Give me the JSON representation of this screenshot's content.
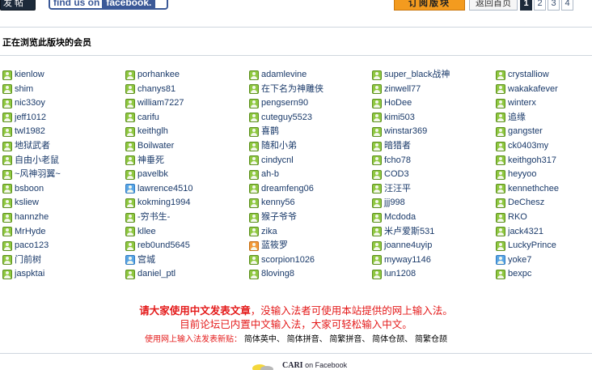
{
  "topbar": {
    "post_label": "发 帖",
    "facebook_find": "find us on",
    "facebook_name": "facebook.",
    "subscribe_label": "订阅版块",
    "back_label": "返回首页",
    "pages": [
      "1",
      "2",
      "3",
      "4"
    ],
    "current_page": "1"
  },
  "section": {
    "title": "正在浏览此版块的会员"
  },
  "members": [
    [
      {
        "name": "kienlow",
        "icon": "green-user-icon"
      },
      {
        "name": "shim",
        "icon": "green-user-icon"
      },
      {
        "name": "nic33oy",
        "icon": "green-user-icon"
      },
      {
        "name": "jeff1012",
        "icon": "green-user-icon"
      },
      {
        "name": "twl1982",
        "icon": "green-user-icon"
      },
      {
        "name": "地狱武者",
        "icon": "green-user-icon"
      },
      {
        "name": "自由小老鼠",
        "icon": "green-user-icon"
      },
      {
        "name": "~风神羽翼~",
        "icon": "green-user-icon"
      },
      {
        "name": "bsboon",
        "icon": "green-user-icon"
      },
      {
        "name": "ksliew",
        "icon": "green-user-icon"
      },
      {
        "name": "hannzhe",
        "icon": "green-user-icon"
      },
      {
        "name": "MrHyde",
        "icon": "green-user-icon"
      },
      {
        "name": "paco123",
        "icon": "green-user-icon"
      },
      {
        "name": "门前树",
        "icon": "green-user-icon"
      },
      {
        "name": "jaspktai",
        "icon": "green-user-icon"
      }
    ],
    [
      {
        "name": "porhankee",
        "icon": "green-user-icon"
      },
      {
        "name": "chanys81",
        "icon": "green-user-icon"
      },
      {
        "name": "william7227",
        "icon": "green-user-icon"
      },
      {
        "name": "carifu",
        "icon": "green-user-icon"
      },
      {
        "name": "keithglh",
        "icon": "green-user-icon"
      },
      {
        "name": "Boilwater",
        "icon": "green-user-icon"
      },
      {
        "name": "神垂死",
        "icon": "green-user-icon"
      },
      {
        "name": "pavelbk",
        "icon": "green-user-icon"
      },
      {
        "name": "lawrence4510",
        "icon": "blue-user-icon"
      },
      {
        "name": "kokming1994",
        "icon": "green-user-icon"
      },
      {
        "name": "-穷书生-",
        "icon": "green-user-icon"
      },
      {
        "name": "kllee",
        "icon": "green-user-icon"
      },
      {
        "name": "reb0und5645",
        "icon": "green-user-icon"
      },
      {
        "name": "宫城",
        "icon": "blue-user-icon"
      },
      {
        "name": "daniel_ptl",
        "icon": "green-user-icon"
      }
    ],
    [
      {
        "name": "adamlevine",
        "icon": "green-user-icon"
      },
      {
        "name": "在下名为神雕侠",
        "icon": "green-user-icon"
      },
      {
        "name": "pengsern90",
        "icon": "green-user-icon"
      },
      {
        "name": "cuteguy5523",
        "icon": "green-user-icon"
      },
      {
        "name": "喜鹊",
        "icon": "green-user-icon"
      },
      {
        "name": "随和小弟",
        "icon": "green-user-icon"
      },
      {
        "name": "cindycnl",
        "icon": "green-user-icon"
      },
      {
        "name": "ah-b",
        "icon": "green-user-icon"
      },
      {
        "name": "dreamfeng06",
        "icon": "green-user-icon"
      },
      {
        "name": "kenny56",
        "icon": "green-user-icon"
      },
      {
        "name": "猴子爷爷",
        "icon": "green-user-icon"
      },
      {
        "name": "zika",
        "icon": "green-user-icon"
      },
      {
        "name": "蓝筱罗",
        "icon": "orange-user-icon"
      },
      {
        "name": "scorpion1026",
        "icon": "green-user-icon"
      },
      {
        "name": "8loving8",
        "icon": "green-user-icon"
      }
    ],
    [
      {
        "name": "super_black战神",
        "icon": "green-user-icon"
      },
      {
        "name": "zinwell77",
        "icon": "green-user-icon"
      },
      {
        "name": "HoDee",
        "icon": "green-user-icon"
      },
      {
        "name": "kimi503",
        "icon": "green-user-icon"
      },
      {
        "name": "winstar369",
        "icon": "green-user-icon"
      },
      {
        "name": "暗猎者",
        "icon": "green-user-icon"
      },
      {
        "name": "fcho78",
        "icon": "green-user-icon"
      },
      {
        "name": "COD3",
        "icon": "green-user-icon"
      },
      {
        "name": "汪汪平",
        "icon": "green-user-icon"
      },
      {
        "name": "jjj998",
        "icon": "green-user-icon"
      },
      {
        "name": "Mcdoda",
        "icon": "green-user-icon"
      },
      {
        "name": "米卢爱斯531",
        "icon": "green-user-icon"
      },
      {
        "name": "joanne4uyip",
        "icon": "green-user-icon"
      },
      {
        "name": "myway1146",
        "icon": "green-user-icon"
      },
      {
        "name": "lun1208",
        "icon": "green-user-icon"
      }
    ],
    [
      {
        "name": "crystalliow",
        "icon": "green-user-icon"
      },
      {
        "name": "wakakafever",
        "icon": "green-user-icon"
      },
      {
        "name": "winterx",
        "icon": "green-user-icon"
      },
      {
        "name": "追缘",
        "icon": "green-user-icon"
      },
      {
        "name": "gangster",
        "icon": "green-user-icon"
      },
      {
        "name": "ck0403my",
        "icon": "green-user-icon"
      },
      {
        "name": "keithgoh317",
        "icon": "green-user-icon"
      },
      {
        "name": "heyyoo",
        "icon": "green-user-icon"
      },
      {
        "name": "kennethchee",
        "icon": "green-user-icon"
      },
      {
        "name": "DeChesz",
        "icon": "green-user-icon"
      },
      {
        "name": "RKO",
        "icon": "green-user-icon"
      },
      {
        "name": "jack4321",
        "icon": "green-user-icon"
      },
      {
        "name": "LuckyPrince",
        "icon": "green-user-icon"
      },
      {
        "name": "yoke7",
        "icon": "blue-user-icon"
      },
      {
        "name": "bexpc",
        "icon": "green-user-icon"
      }
    ]
  ],
  "notice": {
    "line1_bold": "请大家使用中文发表文章",
    "line1_rest": "，没输入法者可使用本站提供的网上输入法。",
    "line2": "目前论坛已内置中文输入法，大家可轻松输入中文。",
    "line3_lead": "使用网上输入法发表新贴：",
    "input_methods": [
      "简体英中",
      "简体拼音",
      "简繁拼音",
      "简体仓颉",
      "简繁仓颉"
    ]
  },
  "footer": {
    "brand": "CARI",
    "suffix": "on Facebook"
  },
  "colors": {
    "notice_red": "#e41a1a",
    "member_link": "#1a3a6a",
    "subscribe_orange": "#f39b1f",
    "facebook_blue": "#3b5998"
  }
}
